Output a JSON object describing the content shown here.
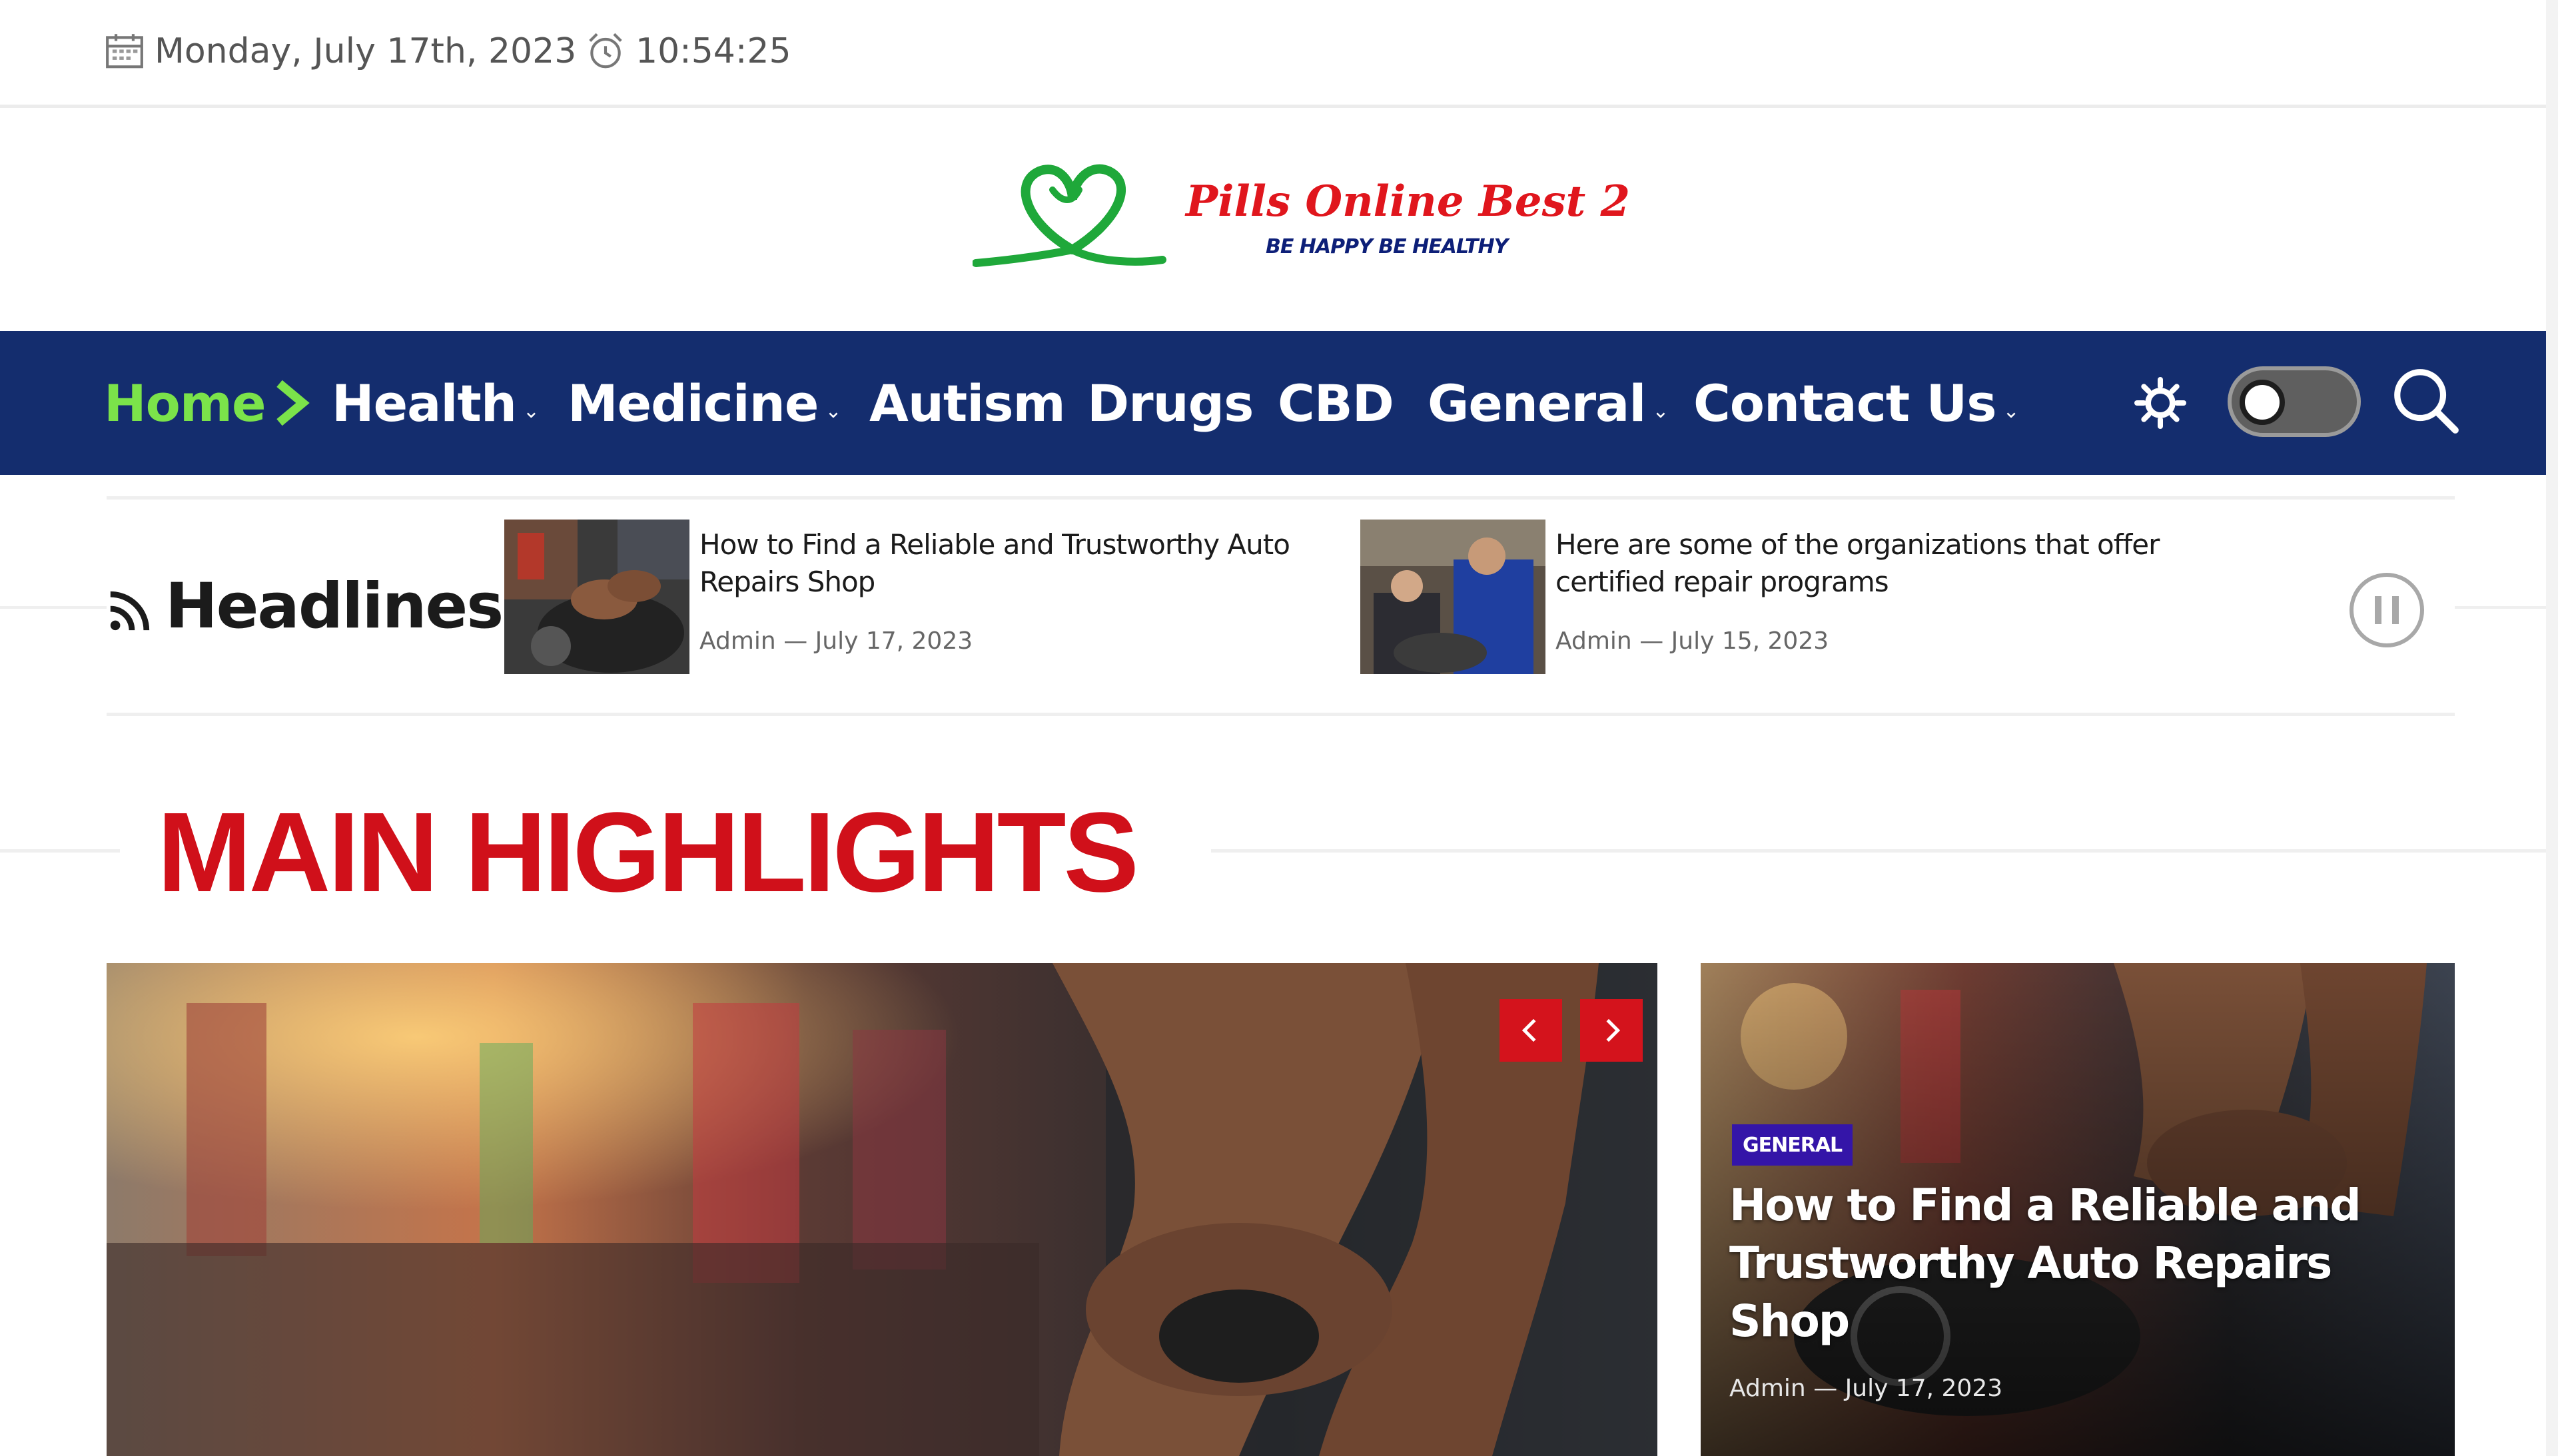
{
  "topbar": {
    "date": "Monday, July 17th, 2023",
    "time": "10:54:25",
    "calendar_icon": "calendar-icon",
    "clock_icon": "alarm-clock-icon"
  },
  "logo": {
    "title": "Pills Online Best 2",
    "tagline": "BE HAPPY BE HEALTHY",
    "heart_color": "#1fa83a"
  },
  "nav": {
    "background": "#142d6e",
    "active_color": "#7be34a",
    "items": [
      {
        "label": "Home",
        "dropdown": false,
        "active": true
      },
      {
        "label": "Health",
        "dropdown": true
      },
      {
        "label": "Medicine",
        "dropdown": true
      },
      {
        "label": "Autism",
        "dropdown": false
      },
      {
        "label": "Drugs",
        "dropdown": false
      },
      {
        "label": "CBD",
        "dropdown": false
      },
      {
        "label": "General",
        "dropdown": true
      },
      {
        "label": "Contact Us",
        "dropdown": true
      }
    ],
    "chevron": "⌄",
    "theme_icon": "sun-icon",
    "toggle_state": "off",
    "search_icon": "search-icon"
  },
  "headlines": {
    "label": "Headlines",
    "items": [
      {
        "title": "How to Find a Reliable and Trustworthy Auto Repairs Shop",
        "author": "Admin",
        "separator": "—",
        "date": "July 17, 2023"
      },
      {
        "title": "Here are some of the organizations that offer certified repair programs",
        "author": "Admin",
        "separator": "—",
        "date": "July 15, 2023"
      }
    ]
  },
  "main_highlights": {
    "title": "MAIN HIGHLIGHTS",
    "accent": "#d0101a",
    "side_post": {
      "category": "GENERAL",
      "title": "How to Find a Reliable and Trustworthy Auto Repairs Shop",
      "author": "Admin",
      "separator": "—",
      "date": "July 17, 2023"
    }
  }
}
